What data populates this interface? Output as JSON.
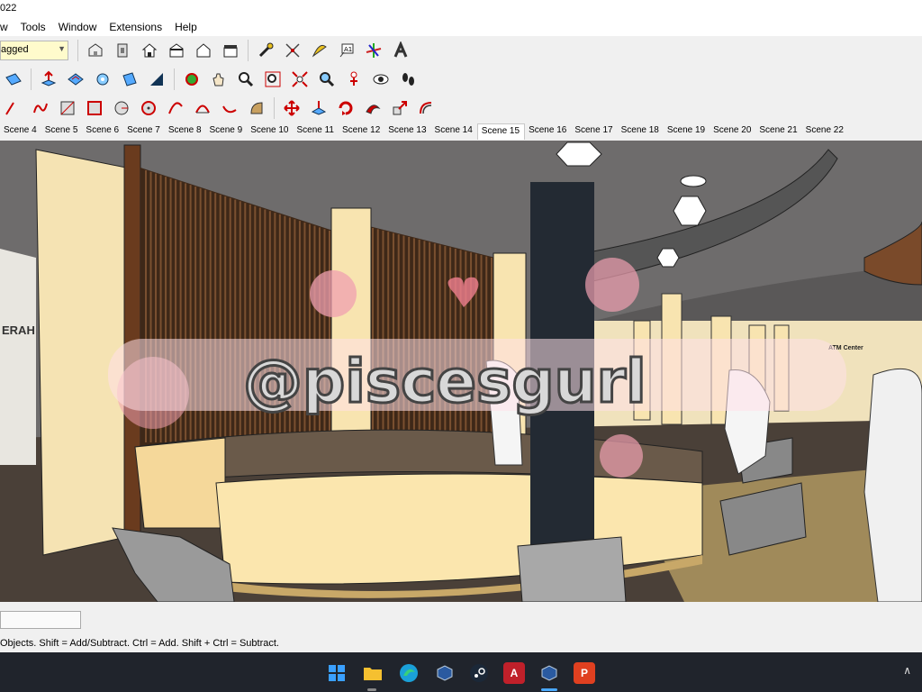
{
  "window": {
    "title_fragment": "022"
  },
  "menu": {
    "items": [
      "w",
      "Tools",
      "Window",
      "Extensions",
      "Help"
    ]
  },
  "toolbar": {
    "tag_select_value": "agged"
  },
  "scenes": {
    "tabs": [
      "Scene 4",
      "Scene 5",
      "Scene 6",
      "Scene 7",
      "Scene 8",
      "Scene 9",
      "Scene 10",
      "Scene 11",
      "Scene 12",
      "Scene 13",
      "Scene 14",
      "Scene 15",
      "Scene 16",
      "Scene 17",
      "Scene 18",
      "Scene 19",
      "Scene 20",
      "Scene 21",
      "Scene 22"
    ],
    "active": "Scene 15"
  },
  "viewport": {
    "left_wall_text": "ERAH",
    "sign_text": "ATM Center",
    "watermark_text": "@piscesgurl"
  },
  "status": {
    "hint": "Objects. Shift = Add/Subtract. Ctrl = Add. Shift + Ctrl = Subtract."
  },
  "taskbar": {
    "apps": [
      "windows-start",
      "file-explorer",
      "edge",
      "sketchup",
      "steam",
      "autocad",
      "sketchup-active",
      "powerpoint"
    ]
  },
  "colors": {
    "counter": "#f5dca0",
    "wood_slats": "#4a2e1e",
    "dark_column": "#232a33",
    "ceiling": "#6a6868",
    "floor": "#4a4038"
  }
}
